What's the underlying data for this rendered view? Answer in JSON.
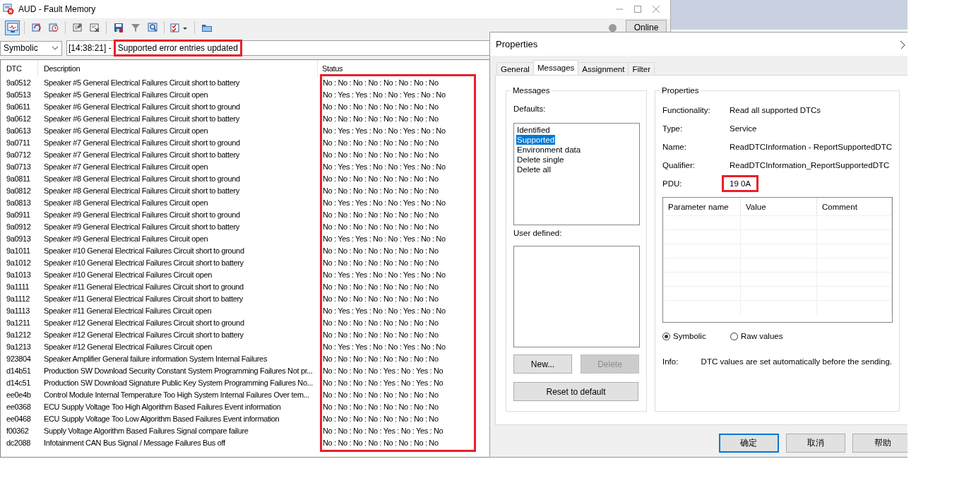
{
  "window": {
    "title": "AUD - Fault Memory"
  },
  "toolbar": {
    "buttons": [
      {
        "kind": "monitor",
        "pressed": true
      },
      {
        "kind": "separator"
      },
      {
        "kind": "refresh",
        "pressed": false
      },
      {
        "kind": "refresh-clock",
        "pressed": false
      },
      {
        "kind": "separator"
      },
      {
        "kind": "note-edit",
        "pressed": false
      },
      {
        "kind": "note-delete",
        "pressed": false
      },
      {
        "kind": "separator"
      },
      {
        "kind": "save",
        "pressed": false
      },
      {
        "kind": "filter",
        "pressed": false
      },
      {
        "kind": "magnifier",
        "pressed": false
      },
      {
        "kind": "separator"
      },
      {
        "kind": "checklist",
        "pressed": false
      },
      {
        "kind": "separator"
      },
      {
        "kind": "folder",
        "pressed": false
      }
    ],
    "online_button": "Online"
  },
  "view_select": {
    "value": "Symbolic"
  },
  "message": {
    "time": "[14:38:21] -",
    "text": "Supported error entries updated",
    "highlighted": true
  },
  "table": {
    "columns": [
      {
        "label": "DTC",
        "highlighted": false
      },
      {
        "label": "Description",
        "highlighted": false
      },
      {
        "label": "Status",
        "highlighted": true
      }
    ],
    "rows": [
      {
        "dtc": "9a0512",
        "description": "Speaker #5 General Electrical Failures Circuit short to battery",
        "status": "No : No : No : No : No : No : No : No"
      },
      {
        "dtc": "9a0513",
        "description": "Speaker #5 General Electrical Failures Circuit open",
        "status": "No : Yes : Yes : No : No : Yes : No : No"
      },
      {
        "dtc": "9a0611",
        "description": "Speaker #6 General Electrical Failures Circuit short to ground",
        "status": "No : No : No : No : No : No : No : No"
      },
      {
        "dtc": "9a0612",
        "description": "Speaker #6 General Electrical Failures Circuit short to battery",
        "status": "No : No : No : No : No : No : No : No"
      },
      {
        "dtc": "9a0613",
        "description": "Speaker #6 General Electrical Failures Circuit open",
        "status": "No : Yes : Yes : No : No : Yes : No : No"
      },
      {
        "dtc": "9a0711",
        "description": "Speaker #7 General Electrical Failures Circuit short to ground",
        "status": "No : No : No : No : No : No : No : No"
      },
      {
        "dtc": "9a0712",
        "description": "Speaker #7 General Electrical Failures Circuit short to battery",
        "status": "No : No : No : No : No : No : No : No"
      },
      {
        "dtc": "9a0713",
        "description": "Speaker #7 General Electrical Failures Circuit open",
        "status": "No : Yes : Yes : No : No : Yes : No : No"
      },
      {
        "dtc": "9a0811",
        "description": "Speaker #8 General Electrical Failures Circuit short to ground",
        "status": "No : No : No : No : No : No : No : No"
      },
      {
        "dtc": "9a0812",
        "description": "Speaker #8 General Electrical Failures Circuit short to battery",
        "status": "No : No : No : No : No : No : No : No"
      },
      {
        "dtc": "9a0813",
        "description": "Speaker #8 General Electrical Failures Circuit open",
        "status": "No : Yes : Yes : No : No : Yes : No : No"
      },
      {
        "dtc": "9a0911",
        "description": "Speaker #9 General Electrical Failures Circuit short to ground",
        "status": "No : No : No : No : No : No : No : No"
      },
      {
        "dtc": "9a0912",
        "description": "Speaker #9 General Electrical Failures Circuit short to battery",
        "status": "No : No : No : No : No : No : No : No"
      },
      {
        "dtc": "9a0913",
        "description": "Speaker #9 General Electrical Failures Circuit open",
        "status": "No : Yes : Yes : No : No : Yes : No : No"
      },
      {
        "dtc": "9a1011",
        "description": "Speaker #10 General Electrical Failures Circuit short to ground",
        "status": "No : No : No : No : No : No : No : No"
      },
      {
        "dtc": "9a1012",
        "description": "Speaker #10 General Electrical Failures Circuit short to battery",
        "status": "No : No : No : No : No : No : No : No"
      },
      {
        "dtc": "9a1013",
        "description": "Speaker #10 General Electrical Failures Circuit open",
        "status": "No : Yes : Yes : No : No : Yes : No : No"
      },
      {
        "dtc": "9a1111",
        "description": "Speaker #11 General Electrical Failures Circuit short to ground",
        "status": "No : No : No : No : No : No : No : No"
      },
      {
        "dtc": "9a1112",
        "description": "Speaker #11 General Electrical Failures Circuit short to battery",
        "status": "No : No : No : No : No : No : No : No"
      },
      {
        "dtc": "9a1113",
        "description": "Speaker #11 General Electrical Failures Circuit open",
        "status": "No : Yes : Yes : No : No : Yes : No : No"
      },
      {
        "dtc": "9a1211",
        "description": "Speaker #12 General Electrical Failures Circuit short to ground",
        "status": "No : No : No : No : No : No : No : No"
      },
      {
        "dtc": "9a1212",
        "description": "Speaker #12 General Electrical Failures Circuit short to battery",
        "status": "No : No : No : No : No : No : No : No"
      },
      {
        "dtc": "9a1213",
        "description": "Speaker #12 General Electrical Failures Circuit open",
        "status": "No : Yes : Yes : No : No : Yes : No : No"
      },
      {
        "dtc": "923804",
        "description": "Speaker Amplifier General failure information System Internal Failures",
        "status": "No : No : No : No : No : No : No : No"
      },
      {
        "dtc": "d14b51",
        "description": "Production SW Download Security Constant System Programming Failures Not pr...",
        "status": "No : No : No : No : Yes : No : Yes : No"
      },
      {
        "dtc": "d14c51",
        "description": "Production SW Download Signature Public Key System Programming Failures No...",
        "status": "No : No : No : No : Yes : No : Yes : No"
      },
      {
        "dtc": "ee0e4b",
        "description": "Control Module Internal Temperature Too High System Internal Failures Over tem...",
        "status": "No : No : No : No : No : No : No : No"
      },
      {
        "dtc": "ee0368",
        "description": "ECU Supply Voltage Too High  Algorithm Based Failures Event information",
        "status": "No : No : No : No : No : No : No : No"
      },
      {
        "dtc": "ee0468",
        "description": "ECU Supply Voltage Too Low Algorithm Based Failures Event information",
        "status": "No : No : No : No : No : No : No : No"
      },
      {
        "dtc": "f00362",
        "description": "Supply Voltage Algorithm Based Failures Signal compare failure",
        "status": "No : No : No : No : Yes : No : Yes : No"
      },
      {
        "dtc": "dc2088",
        "description": "Infotainment CAN Bus Signal / Message Failures Bus off",
        "status": "No : No : No : No : No : No : No : No"
      }
    ]
  },
  "dialog": {
    "title": "Properties",
    "tabs": [
      {
        "label": "General",
        "selected": false
      },
      {
        "label": "Messages",
        "selected": true
      },
      {
        "label": "Assignment",
        "selected": false
      },
      {
        "label": "Filter",
        "selected": false
      }
    ],
    "messages_group": {
      "title": "Messages",
      "defaults_label": "Defaults:",
      "defaults": [
        {
          "label": "Identified",
          "selected": false
        },
        {
          "label": "Supported",
          "selected": true
        },
        {
          "label": "Environment data",
          "selected": false
        },
        {
          "label": "Delete single",
          "selected": false
        },
        {
          "label": "Delete all",
          "selected": false
        }
      ],
      "user_defined_label": "User defined:",
      "buttons": [
        {
          "label": "New...",
          "disabled": false
        },
        {
          "label": "Delete",
          "disabled": true
        }
      ],
      "reset_button": "Reset to default"
    },
    "properties_group": {
      "title": "Properties",
      "fields": [
        {
          "label": "Functionality:",
          "value": "Read all supported DTCs",
          "highlighted": false
        },
        {
          "label": "Type:",
          "value": "Service",
          "highlighted": false
        },
        {
          "label": "Name:",
          "value": "ReadDTCInformation - ReportSupportedDTC",
          "highlighted": false
        },
        {
          "label": "Qualifier:",
          "value": "ReadDTCInformation_ReportSupportedDTC",
          "highlighted": false
        },
        {
          "label": "PDU:",
          "value": "19 0A",
          "highlighted": true
        }
      ],
      "parameter_table": {
        "columns": [
          "Parameter name",
          "Value",
          "Comment"
        ]
      },
      "radios": [
        {
          "label": "Symbolic",
          "selected": true
        },
        {
          "label": "Raw values",
          "selected": false
        }
      ],
      "info_label": "Info:",
      "info": "DTC values are set automatically before the sending."
    },
    "buttons": [
      {
        "label": "确定",
        "focused": true
      },
      {
        "label": "取消",
        "focused": false
      },
      {
        "label": "帮助",
        "focused": false
      }
    ]
  }
}
